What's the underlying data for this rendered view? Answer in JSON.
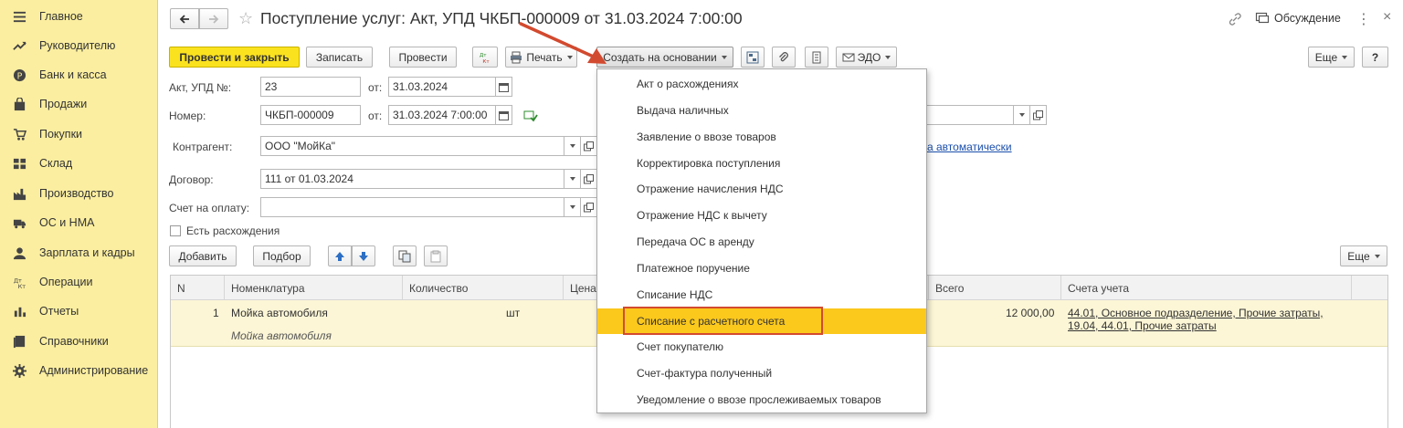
{
  "sidebar": {
    "items": [
      {
        "label": "Главное",
        "icon": "menu-icon"
      },
      {
        "label": "Руководителю",
        "icon": "trend-icon"
      },
      {
        "label": "Банк и касса",
        "icon": "coin-icon"
      },
      {
        "label": "Продажи",
        "icon": "bag-icon"
      },
      {
        "label": "Покупки",
        "icon": "cart-icon"
      },
      {
        "label": "Склад",
        "icon": "warehouse-icon"
      },
      {
        "label": "Производство",
        "icon": "factory-icon"
      },
      {
        "label": "ОС и НМА",
        "icon": "truck-icon"
      },
      {
        "label": "Зарплата и кадры",
        "icon": "person-icon"
      },
      {
        "label": "Операции",
        "icon": "dt-kt-icon"
      },
      {
        "label": "Отчеты",
        "icon": "bar-chart-icon"
      },
      {
        "label": "Справочники",
        "icon": "book-icon"
      },
      {
        "label": "Администрирование",
        "icon": "gear-icon"
      }
    ]
  },
  "header": {
    "title": "Поступление услуг: Акт, УПД ЧКБП-000009 от 31.03.2024 7:00:00",
    "discussion": "Обсуждение"
  },
  "toolbar": {
    "post_close": "Провести и закрыть",
    "save": "Записать",
    "post": "Провести",
    "dtkt": "Дт Кт",
    "print": "Печать",
    "create_based": "Создать на основании",
    "edo": "ЭДО",
    "more": "Еще",
    "help": "?"
  },
  "form": {
    "act_label": "Акт, УПД №:",
    "act_value": "23",
    "from_label": "от:",
    "act_date": "31.03.2024",
    "number_label": "Номер:",
    "number_value": "ЧКБП-000009",
    "number_date": "31.03.2024  7:00:00",
    "contractor_label": "Контрагент:",
    "contractor_value": "ООО \"МойКа\"",
    "contract_label": "Договор:",
    "contract_value": "111 от 01.03.2024",
    "invoice_label": "Счет на оплату:",
    "invoice_value": "",
    "auto_link": "а автоматически",
    "discrepancy_label": "Есть расхождения"
  },
  "table_toolbar": {
    "add": "Добавить",
    "select": "Подбор",
    "more": "Еще"
  },
  "table": {
    "columns": [
      "N",
      "Номенклатура",
      "Количество",
      "Цена",
      "Всего",
      "Счета учета"
    ],
    "rows": [
      {
        "n": "1",
        "item": "Мойка автомобиля",
        "item_sub": "Мойка автомобиля",
        "unit": "шт",
        "total": "12 000,00",
        "accounts_line1": "44.01, Основное подразделение, Прочие затраты,",
        "accounts_line2": "19.04, 44.01, Прочие затраты"
      }
    ]
  },
  "dropdown": {
    "items": [
      "Акт о расхождениях",
      "Выдача наличных",
      "Заявление о ввозе товаров",
      "Корректировка поступления",
      "Отражение начисления НДС",
      "Отражение НДС к вычету",
      "Передача ОС в аренду",
      "Платежное поручение",
      "Списание НДС",
      "Списание с расчетного счета",
      "Счет покупателю",
      "Счет-фактура полученный",
      "Уведомление о ввозе прослеживаемых товаров"
    ],
    "highlighted_index": 9
  },
  "colors": {
    "sidebar_bg": "#fbeea0",
    "primary_button": "#fbe21f",
    "highlight": "#fbc81c",
    "annotation_red": "#d24a2f",
    "link": "#1a4eab"
  }
}
